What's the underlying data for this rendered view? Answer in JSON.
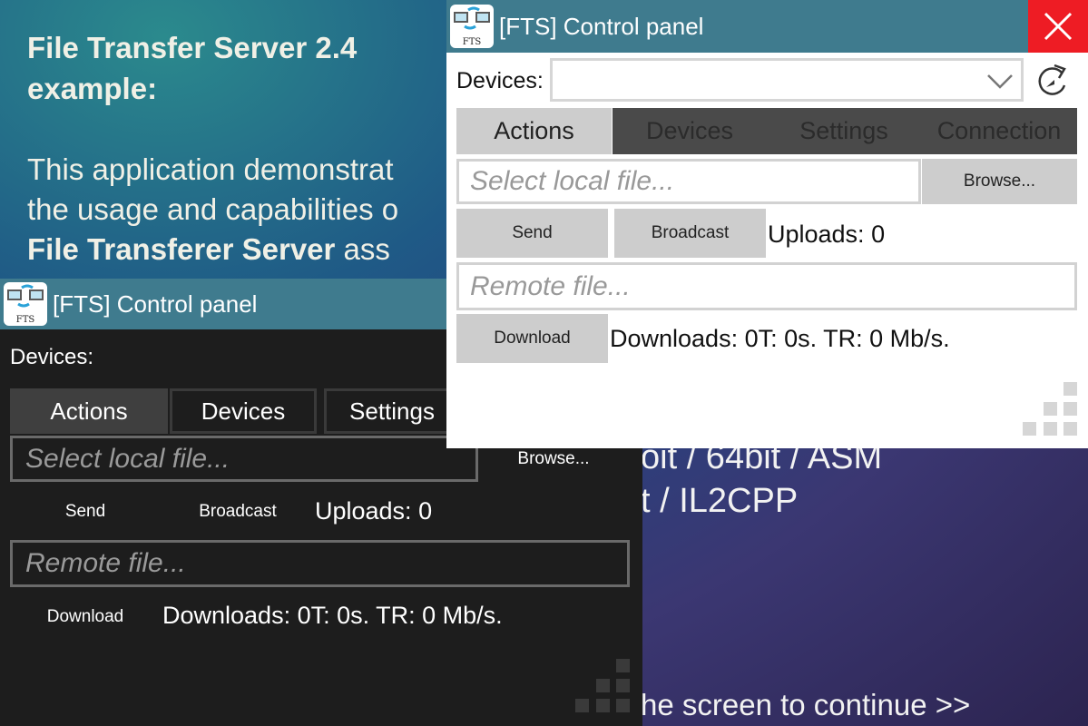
{
  "background": {
    "title": "File Transfer Server 2.4 example:",
    "body_line1": "This application demonstrat",
    "body_line2": "the usage and capabilities o",
    "body_line3_bold": "File Transferer Server",
    "body_line3_rest": " ass",
    "lower_line1": "oit / 64bit / ASM",
    "lower_line2": "t / IL2CPP",
    "continue_hint": "he screen to continue >>"
  },
  "dark_panel": {
    "title": "[FTS] Control panel",
    "devices_label": "Devices:",
    "tabs": [
      {
        "label": "Actions",
        "active": true
      },
      {
        "label": "Devices",
        "active": false
      },
      {
        "label": "Settings",
        "active": false
      }
    ],
    "local_file_placeholder": "Select local file...",
    "browse_label": "Browse...",
    "send_label": "Send",
    "broadcast_label": "Broadcast",
    "uploads_status": "Uploads: 0",
    "remote_file_placeholder": "Remote file...",
    "download_label": "Download",
    "downloads_status": "Downloads: 0T: 0s. TR: 0 Mb/s."
  },
  "light_panel": {
    "title": "[FTS] Control panel",
    "devices_label": "Devices:",
    "devices_selected": "",
    "tabs": [
      {
        "label": "Actions",
        "active": true
      },
      {
        "label": "Devices",
        "active": false
      },
      {
        "label": "Settings",
        "active": false
      },
      {
        "label": "Connection",
        "active": false
      }
    ],
    "local_file_placeholder": "Select local file...",
    "browse_label": "Browse...",
    "send_label": "Send",
    "broadcast_label": "Broadcast",
    "uploads_status": "Uploads: 0",
    "remote_file_placeholder": "Remote file...",
    "download_label": "Download",
    "downloads_status": "Downloads: 0T: 0s. TR: 0 Mb/s."
  },
  "app_icon_text": "FTS",
  "colors": {
    "titlebar": "#3f7b8e",
    "close": "#ee1c24",
    "dark_panel_bg": "#1d1d1d",
    "light_button": "#cdcdcd"
  },
  "icons": [
    "fts-app-icon",
    "close-icon",
    "chevron-down-icon",
    "refresh-icon",
    "resize-grip-icon"
  ]
}
